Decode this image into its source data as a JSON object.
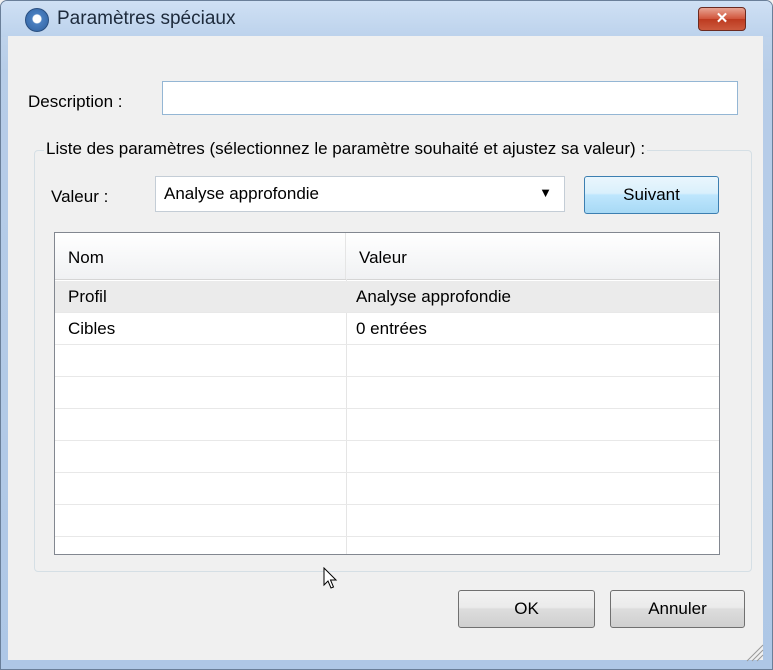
{
  "window": {
    "title": "Paramètres spéciaux",
    "icon": "app-settings-icon",
    "close_glyph": "✕"
  },
  "description": {
    "label": "Description :",
    "value": ""
  },
  "parameters_group": {
    "label": "Liste des paramètres (sélectionnez le paramètre souhaité et ajustez sa valeur) :",
    "value_label": "Valeur :",
    "value_selected": "Analyse approfondie",
    "dropdown_arrow": "▼",
    "next_button": "Suivant",
    "columns": [
      "Nom",
      "Valeur"
    ],
    "rows": [
      {
        "name": "Profil",
        "value": "Analyse approfondie",
        "selected": true
      },
      {
        "name": "Cibles",
        "value": "0 entrées",
        "selected": false
      }
    ]
  },
  "footer": {
    "ok": "OK",
    "cancel": "Annuler"
  }
}
